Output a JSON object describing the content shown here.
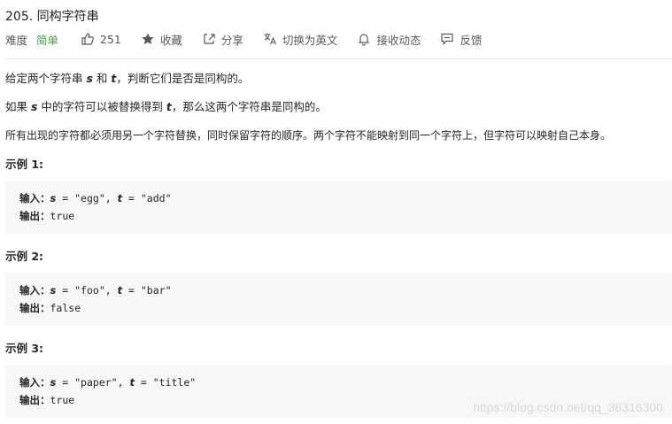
{
  "problem": {
    "title": "205. 同构字符串",
    "difficulty_label": "难度",
    "difficulty_value": "简单",
    "likes": "251",
    "favorite": "收藏",
    "share": "分享",
    "switch_lang": "切换为英文",
    "subscribe": "接收动态",
    "feedback": "反馈",
    "difficulty_color": "#43a047"
  },
  "description": {
    "p1_a": "给定两个字符串 ",
    "p1_s": "s",
    "p1_b": " 和 ",
    "p1_t": "t",
    "p1_c": "，判断它们是否是同构的。",
    "p2_a": "如果 ",
    "p2_s": "s",
    "p2_b": " 中的字符可以被替换得到 ",
    "p2_t": "t",
    "p2_c": "，那么这两个字符串是同构的。",
    "p3": "所有出现的字符都必须用另一个字符替换，同时保留字符的顺序。两个字符不能映射到同一个字符上，但字符可以映射自己本身。"
  },
  "examples": [
    {
      "title": "示例 1:",
      "input_label": "输入：",
      "s_var": "s",
      "s_val": " = \"egg\", ",
      "t_var": "t",
      "t_val": " = \"add\"",
      "output_label": "输出：",
      "output": "true"
    },
    {
      "title": "示例 2:",
      "input_label": "输入：",
      "s_var": "s",
      "s_val": " = \"foo\", ",
      "t_var": "t",
      "t_val": " = \"bar\"",
      "output_label": "输出：",
      "output": "false"
    },
    {
      "title": "示例 3:",
      "input_label": "输入：",
      "s_var": "s",
      "s_val": " = \"paper\", ",
      "t_var": "t",
      "t_val": " = \"title\"",
      "output_label": "输出：",
      "output": "true"
    }
  ],
  "watermark": "https://blog.csdn.net/qq_38316300",
  "icons": [
    "thumbs-up-icon",
    "star-icon",
    "share-icon",
    "translate-icon",
    "bell-icon",
    "comment-icon"
  ]
}
